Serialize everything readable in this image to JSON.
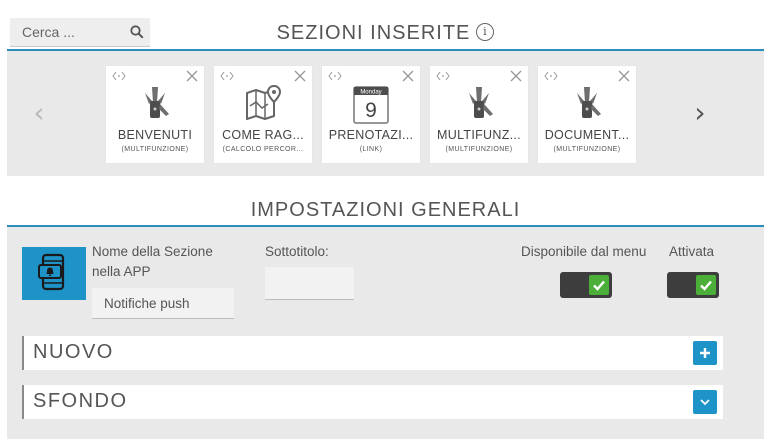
{
  "search": {
    "placeholder": "Cerca ..."
  },
  "inserted_sections": {
    "title": "SEZIONI INSERITE",
    "info_symbol": "i",
    "cards": [
      {
        "title": "BENVENUTI",
        "subtitle": "(MULTIFUNZIONE)",
        "icon": "swiss-knife-icon"
      },
      {
        "title": "COME RAG...",
        "subtitle": "(CALCOLO PERCOR...",
        "icon": "map-icon"
      },
      {
        "title": "PRENOTAZI...",
        "subtitle": "(LINK)",
        "icon": "calendar-icon",
        "calendar_month": "Monday",
        "calendar_day": "9"
      },
      {
        "title": "MULTIFUNZ...",
        "subtitle": "(MULTIFUNZIONE)",
        "icon": "swiss-knife-icon"
      },
      {
        "title": "DOCUMENT...",
        "subtitle": "(MULTIFUNZIONE)",
        "icon": "swiss-knife-icon"
      }
    ]
  },
  "general_settings": {
    "title": "IMPOSTAZIONI GENERALI",
    "section_name_label": "Nome della Sezione nella APP",
    "section_name_value": "Notifiche push",
    "subtitle_label": "Sottotitolo:",
    "subtitle_value": "",
    "menu_available_label": "Disponibile dal menu",
    "menu_available": true,
    "active_label": "Attivata",
    "active": true
  },
  "accordions": {
    "nuovo": {
      "label": "NUOVO",
      "icon": "plus-icon"
    },
    "sfondo": {
      "label": "SFONDO",
      "icon": "chevron-down-icon"
    }
  },
  "colors": {
    "accent_blue": "#1e93c8",
    "rule_blue": "#2b8fb9",
    "toggle_green": "#4caf3a",
    "toggle_dark": "#3d3d3d",
    "panel_gray": "#e9e9e9"
  }
}
